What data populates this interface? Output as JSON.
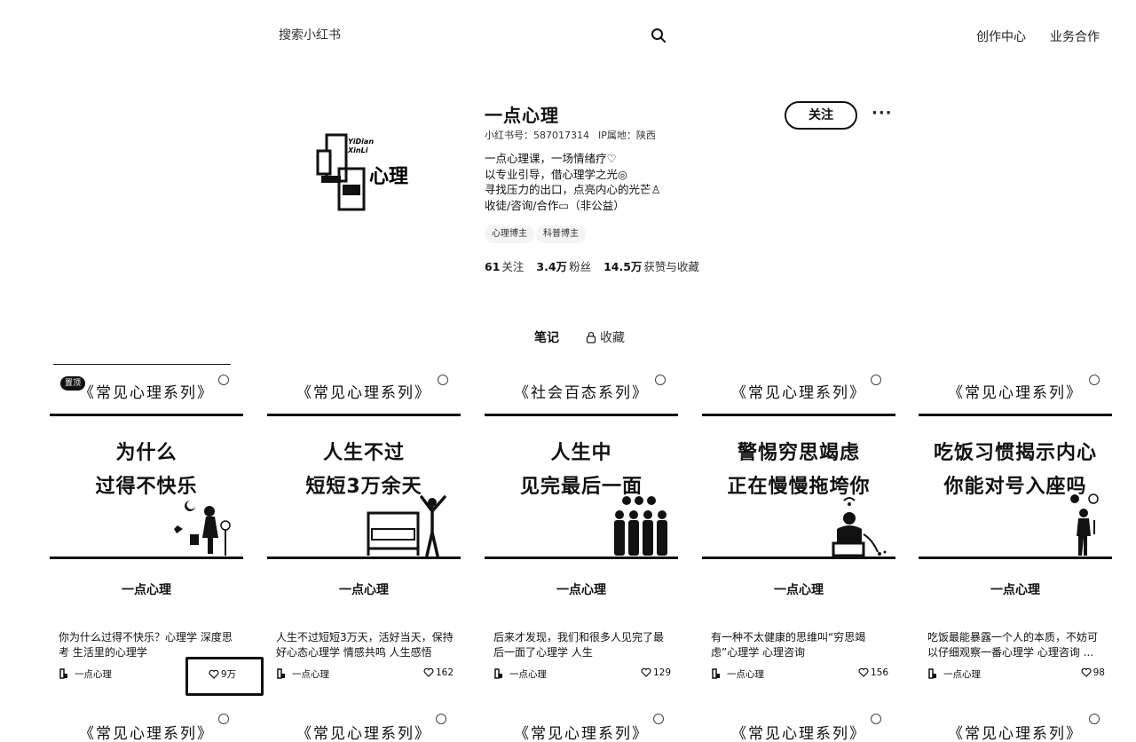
{
  "header": {
    "search_placeholder": "搜索小红书",
    "nav": [
      "创作中心",
      "业务合作"
    ]
  },
  "profile": {
    "avatar_text": [
      "YiDian",
      "XinLi",
      "心理"
    ],
    "name": "一点心理",
    "id_label": "小红书号：587017314",
    "ip_label": "IP属地：陕西",
    "bio": [
      "一点心理课，一场情绪疗♡",
      "以专业引导，借心理学之光◎",
      "寻找压力的出口，点亮内心的光芒♙",
      "收徒/咨询/合作▭（非公益）"
    ],
    "tags": [
      "心理博主",
      "科普博主"
    ],
    "stats": [
      {
        "num": "61",
        "label": "关注"
      },
      {
        "num": "3.4万",
        "label": "粉丝"
      },
      {
        "num": "14.5万",
        "label": "获赞与收藏"
      }
    ],
    "follow_label": "关注",
    "more_label": "···"
  },
  "tabs": {
    "notes": "笔记",
    "collect": "收藏"
  },
  "cards": [
    {
      "series": "《常见心理系列》",
      "badge": "置顶",
      "title": [
        "为什么",
        "过得不快乐"
      ],
      "brand": "一点心理",
      "desc": "你为什么过得不快乐？心理学 深度思考 生活里的心理学",
      "author": "一点心理",
      "likes": "9万"
    },
    {
      "series": "《常见心理系列》",
      "badge": "",
      "title": [
        "人生不过",
        "短短3万余天"
      ],
      "brand": "一点心理",
      "desc": "人生不过短短3万天，活好当天，保持好心态心理学 情感共鸣 人生感悟",
      "author": "一点心理",
      "likes": "162"
    },
    {
      "series": "《社会百态系列》",
      "badge": "",
      "title": [
        "人生中",
        "见完最后一面"
      ],
      "brand": "一点心理",
      "desc": "后来才发现，我们和很多人见完了最后一面了心理学 人生",
      "author": "一点心理",
      "likes": "129"
    },
    {
      "series": "《常见心理系列》",
      "badge": "",
      "title": [
        "警惕穷思竭虑",
        "正在慢慢拖垮你"
      ],
      "brand": "一点心理",
      "desc": "有一种不太健康的思维叫“穷思竭虑”心理学 心理咨询",
      "author": "一点心理",
      "likes": "156"
    },
    {
      "series": "《常见心理系列》",
      "badge": "",
      "title": [
        "吃饭习惯揭示内心",
        "你能对号入座吗"
      ],
      "brand": "一点心理",
      "desc": "吃饭最能暴露一个人的本质，不妨可以仔细观察一番心理学 心理咨询 ...",
      "author": "一点心理",
      "likes": "98"
    }
  ],
  "row2_series": [
    "《常见心理系列》",
    "《常见心理系列》",
    "《常见心理系列》",
    "《常见心理系列》",
    "《常见心理系列》"
  ]
}
